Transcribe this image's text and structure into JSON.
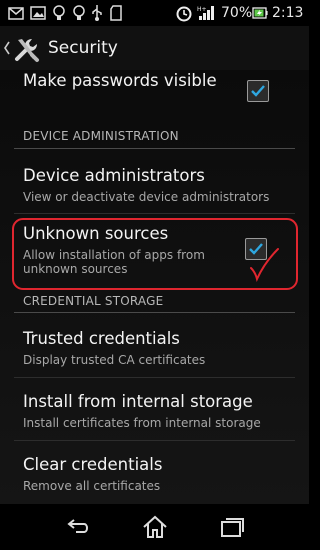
{
  "status_bar": {
    "battery_percent": "70%",
    "time": "2:13"
  },
  "action_bar": {
    "title": "Security",
    "back_icon": "chevron-left-icon",
    "app_icon": "tools-icon"
  },
  "items": {
    "make_passwords": {
      "title": "Make passwords visible",
      "checked": true
    },
    "device_admin_header": "DEVICE ADMINISTRATION",
    "device_admins": {
      "title": "Device administrators",
      "summary": "View or deactivate device administrators"
    },
    "unknown_sources": {
      "title": "Unknown sources",
      "summary": "Allow installation of apps from unknown sources",
      "checked": true
    },
    "credential_header": "CREDENTIAL STORAGE",
    "trusted": {
      "title": "Trusted credentials",
      "summary": "Display trusted CA certificates"
    },
    "install": {
      "title": "Install from internal storage",
      "summary": "Install certificates from internal storage"
    },
    "clear": {
      "title": "Clear credentials",
      "summary": "Remove all certificates"
    }
  },
  "annotation": {
    "highlight_color": "#e0262f"
  },
  "colors": {
    "checkmark": "#2ea7e0"
  }
}
